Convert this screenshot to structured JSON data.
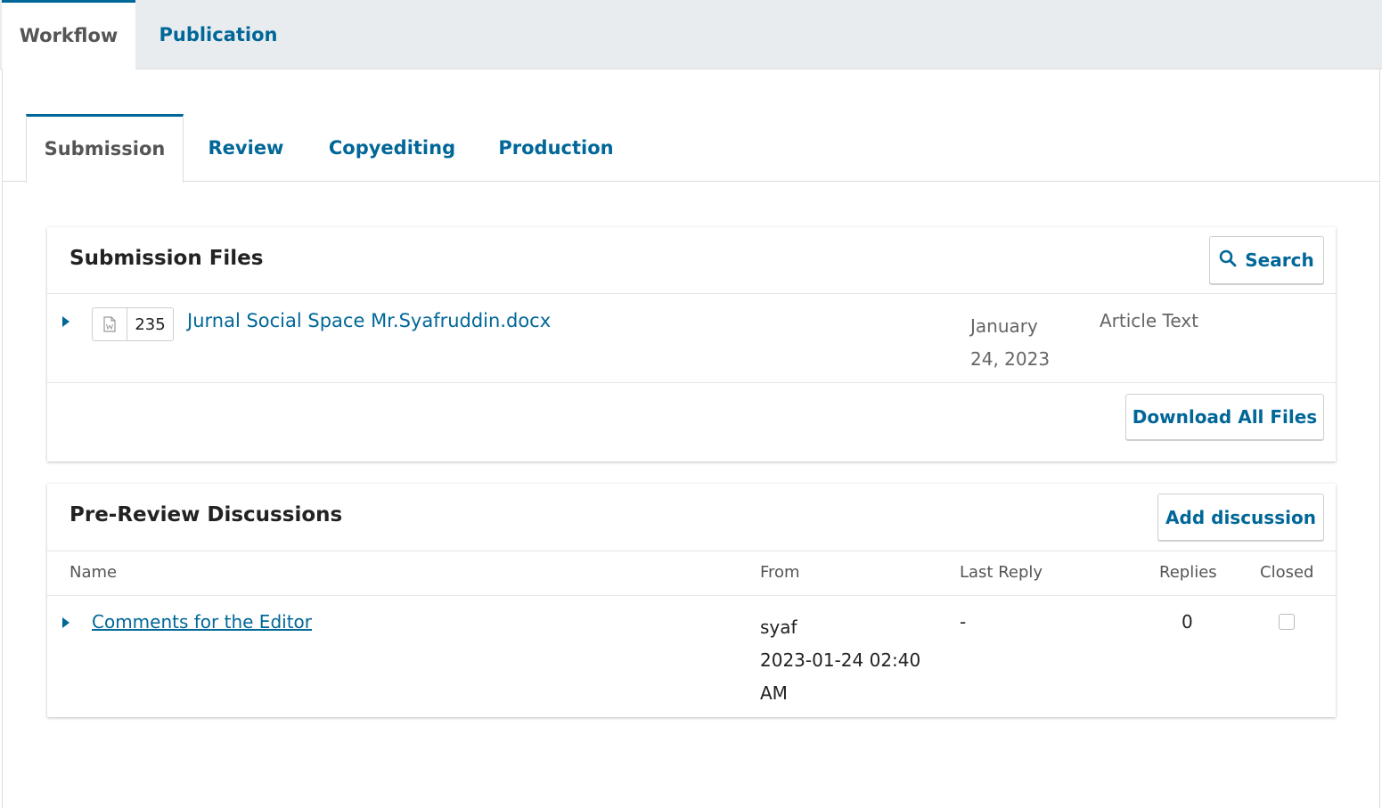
{
  "top_tabs": [
    {
      "label": "Workflow",
      "active": true
    },
    {
      "label": "Publication",
      "active": false
    }
  ],
  "stage_tabs": [
    {
      "label": "Submission",
      "active": true
    },
    {
      "label": "Review",
      "active": false
    },
    {
      "label": "Copyediting",
      "active": false
    },
    {
      "label": "Production",
      "active": false
    }
  ],
  "submission_files": {
    "title": "Submission Files",
    "search_label": "Search",
    "files": [
      {
        "id": "235",
        "name": "Jurnal Social Space Mr.Syafruddin.docx",
        "date_line1": "January",
        "date_line2": "24, 2023",
        "type": "Article Text",
        "icon": "word-document-icon"
      }
    ],
    "download_all_label": "Download All Files"
  },
  "discussions": {
    "title": "Pre-Review Discussions",
    "add_label": "Add discussion",
    "columns": {
      "name": "Name",
      "from": "From",
      "last_reply": "Last Reply",
      "replies": "Replies",
      "closed": "Closed"
    },
    "rows": [
      {
        "name": "Comments for the Editor",
        "from_user": "syaf",
        "from_date": "2023-01-24 02:40",
        "from_time": "AM",
        "last_reply": "-",
        "replies": "0",
        "closed": false
      }
    ]
  },
  "colors": {
    "accent": "#006798",
    "tab_bar": "#e9ecef"
  }
}
